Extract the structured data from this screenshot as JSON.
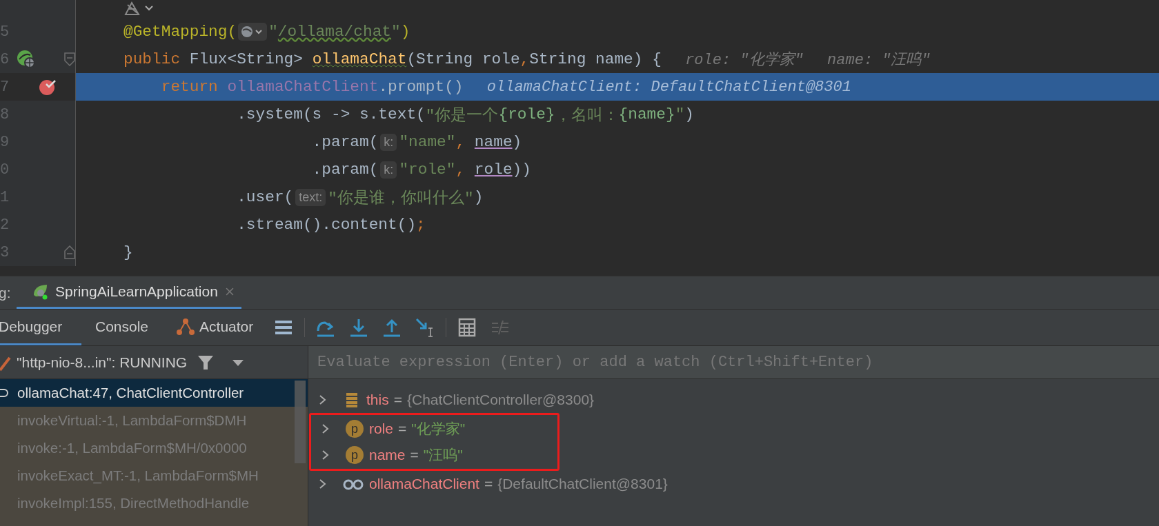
{
  "editor": {
    "lines": [
      {
        "kind": "icon-row",
        "current": false
      },
      {
        "number": "5",
        "current": false,
        "tokens": [
          {
            "kind": "annotation",
            "text": "@GetMapping("
          },
          {
            "kind": "inlay-icon"
          },
          {
            "kind": "string",
            "text": "\""
          },
          {
            "kind": "url",
            "text": "/ollama/chat"
          },
          {
            "kind": "string",
            "text": "\""
          },
          {
            "kind": "annotation",
            "text": ")"
          }
        ]
      },
      {
        "number": "6",
        "current": false,
        "gutter_icons": [
          {
            "kind": "web"
          },
          {
            "kind": "fold-start"
          }
        ],
        "tokens": [
          {
            "kind": "keyword",
            "text": "public"
          },
          {
            "kind": "plain",
            "text": " Flux<String> "
          },
          {
            "kind": "method",
            "text": "ollamaChat"
          },
          {
            "kind": "plain",
            "text": "(String role"
          },
          {
            "kind": "punct",
            "text": ","
          },
          {
            "kind": "plain",
            "text": "String name) {"
          }
        ],
        "inline_values": [
          "role: \"化学家\"",
          "name: \"汪呜\""
        ]
      },
      {
        "number": "7",
        "current": true,
        "gutter_icons": [
          {
            "kind": "breakpoint"
          }
        ],
        "tokens": [
          {
            "kind": "keyword",
            "text": "return "
          },
          {
            "kind": "field",
            "text": "ollamaChatClient"
          },
          {
            "kind": "plain",
            "text": ".prompt()"
          }
        ],
        "inline_values": [
          "ollamaChatClient: DefaultChatClient@8301"
        ]
      },
      {
        "number": "8",
        "current": false,
        "tokens": [
          {
            "kind": "plain",
            "text": ".system(s -> s.text("
          },
          {
            "kind": "string",
            "text": "\"你是一个"
          },
          {
            "kind": "string-var",
            "text": "{role}"
          },
          {
            "kind": "string",
            "text": "，名叫："
          },
          {
            "kind": "string-var",
            "text": "{name}"
          },
          {
            "kind": "string",
            "text": "\""
          },
          {
            "kind": "plain",
            "text": ")"
          }
        ]
      },
      {
        "number": "9",
        "current": false,
        "tokens": [
          {
            "kind": "plain",
            "text": ".param("
          },
          {
            "kind": "inlay",
            "text": "k:"
          },
          {
            "kind": "string",
            "text": "\"name\""
          },
          {
            "kind": "punct",
            "text": ", "
          },
          {
            "kind": "param-ref",
            "text": "name"
          },
          {
            "kind": "plain",
            "text": ")"
          }
        ]
      },
      {
        "number": "0",
        "current": false,
        "tokens": [
          {
            "kind": "plain",
            "text": ".param("
          },
          {
            "kind": "inlay",
            "text": "k:"
          },
          {
            "kind": "string",
            "text": "\"role\""
          },
          {
            "kind": "punct",
            "text": ", "
          },
          {
            "kind": "param-ref",
            "text": "role"
          },
          {
            "kind": "plain",
            "text": "))"
          }
        ]
      },
      {
        "number": "1",
        "current": false,
        "tokens": [
          {
            "kind": "plain",
            "text": ".user("
          },
          {
            "kind": "inlay",
            "text": "text:"
          },
          {
            "kind": "string",
            "text": "\"你是谁，你叫什么\""
          },
          {
            "kind": "plain",
            "text": ")"
          }
        ]
      },
      {
        "number": "2",
        "current": false,
        "tokens": [
          {
            "kind": "plain",
            "text": ".stream().content()"
          },
          {
            "kind": "punct",
            "text": ";"
          }
        ]
      },
      {
        "number": "3",
        "current": false,
        "gutter_icons": [
          {
            "kind": "fold-end"
          }
        ],
        "tokens": [
          {
            "kind": "plain",
            "text": "}"
          }
        ]
      }
    ]
  },
  "debug_bar": {
    "label": "g:",
    "tabs": [
      {
        "label": "SpringAiLearnApplication",
        "selected": true
      }
    ]
  },
  "toolbar": {
    "tabs": [
      {
        "label": "Debugger",
        "selected": true,
        "kind": "plain"
      },
      {
        "label": "Console",
        "selected": false,
        "kind": "plain"
      },
      {
        "label": "Actuator",
        "selected": false,
        "kind": "actuator"
      }
    ],
    "actions": [
      {
        "kind": "layout",
        "disabled": false
      },
      {
        "kind": "step-over",
        "disabled": false
      },
      {
        "kind": "step-into",
        "disabled": false
      },
      {
        "kind": "step-out",
        "disabled": false
      },
      {
        "kind": "run-to-cursor",
        "disabled": false
      },
      {
        "kind": "evaluate",
        "disabled": false
      },
      {
        "kind": "trace",
        "disabled": true
      }
    ]
  },
  "frames": {
    "thread": "\"http-nio-8...in\": RUNNING",
    "items": [
      {
        "text": "ollamaChat:47, ChatClientController",
        "selected": true,
        "library": false
      },
      {
        "text": "invokeVirtual:-1, LambdaForm$DMH",
        "selected": false,
        "library": true
      },
      {
        "text": "invoke:-1, LambdaForm$MH/0x0000",
        "selected": false,
        "library": true
      },
      {
        "text": "invokeExact_MT:-1, LambdaForm$MH",
        "selected": false,
        "library": true
      },
      {
        "text": "invokeImpl:155, DirectMethodHandle",
        "selected": false,
        "library": true
      }
    ]
  },
  "variables": {
    "placeholder": "Evaluate expression (Enter) or add a watch (Ctrl+Shift+Enter)",
    "items": [
      {
        "kind": "field",
        "name": "this",
        "operator": "=",
        "value": {
          "kind": "object",
          "text": "{ChatClientController@8300}"
        },
        "annotated": false
      },
      {
        "kind": "param",
        "badge": "p",
        "name": "role",
        "operator": "=",
        "value": {
          "kind": "string",
          "text": "\"化学家\""
        },
        "annotated": true
      },
      {
        "kind": "param",
        "badge": "p",
        "name": "name",
        "operator": "=",
        "value": {
          "kind": "string",
          "text": "\"汪呜\""
        },
        "annotated": true
      },
      {
        "kind": "watch",
        "name": "ollamaChatClient",
        "operator": "=",
        "value": {
          "kind": "object",
          "text": "{DefaultChatClient@8301}"
        },
        "annotated": false
      }
    ]
  }
}
